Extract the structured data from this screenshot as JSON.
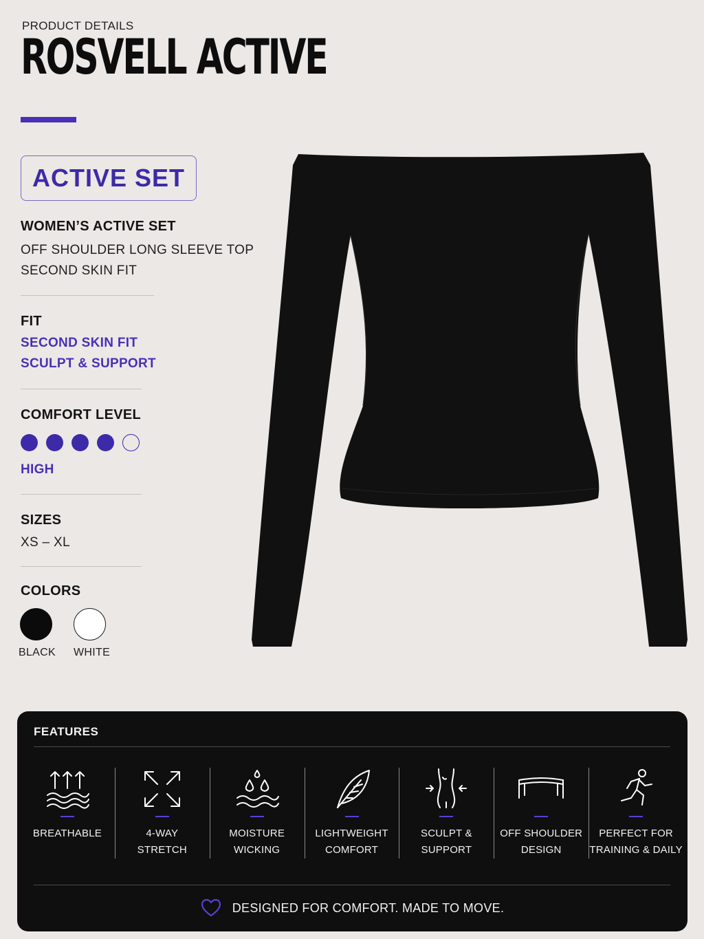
{
  "header": {
    "eyebrow": "PRODUCT DETAILS",
    "brand": "ROSVELL ACTIVE"
  },
  "badge": {
    "label": "ACTIVE SET"
  },
  "summary": {
    "title": "WOMEN’S ACTIVE SET",
    "lines": [
      "OFF SHOULDER LONG SLEEVE TOP",
      "SECOND SKIN FIT"
    ]
  },
  "fit": {
    "heading": "FIT",
    "values": [
      "SECOND SKIN FIT",
      "SCULPT & SUPPORT"
    ]
  },
  "comfort": {
    "heading": "COMFORT LEVEL",
    "rating": 4,
    "max": 5,
    "label": "HIGH"
  },
  "sizes": {
    "heading": "SIZES",
    "range": "XS – XL"
  },
  "colors": {
    "heading": "COLORS",
    "options": [
      {
        "name": "BLACK",
        "hex": "#0b0b0b"
      },
      {
        "name": "WHITE",
        "hex": "#ffffff"
      }
    ]
  },
  "product_image": {
    "description_icon": "off-shoulder-long-sleeve-top",
    "color": "#111111"
  },
  "features": {
    "title": "FEATURES",
    "items": [
      {
        "icon": "breathable-icon",
        "label": "BREATHABLE"
      },
      {
        "icon": "stretch-icon",
        "label": "4-WAY\nSTRETCH"
      },
      {
        "icon": "moisture-icon",
        "label": "MOISTURE\nWICKING"
      },
      {
        "icon": "feather-icon",
        "label": "LIGHTWEIGHT\nCOMFORT"
      },
      {
        "icon": "sculpt-icon",
        "label": "SCULPT &\nSUPPORT"
      },
      {
        "icon": "off-shoulder-icon",
        "label": "OFF SHOULDER\nDESIGN"
      },
      {
        "icon": "runner-icon",
        "label": "PERFECT FOR\nTRAINING & DAILY"
      }
    ],
    "footer": {
      "icon": "heart-icon",
      "text": "DESIGNED FOR COMFORT. MADE TO MOVE."
    }
  },
  "theme": {
    "accent": "#4b2fb6",
    "background": "#ece8e6",
    "panel": "#0f0f0f"
  }
}
